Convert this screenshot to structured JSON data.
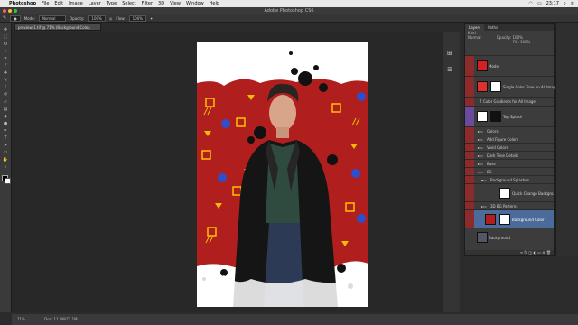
{
  "menubar": {
    "app": "Photoshop",
    "items": [
      "File",
      "Edit",
      "Image",
      "Layer",
      "Type",
      "Select",
      "Filter",
      "3D",
      "View",
      "Window",
      "Help"
    ],
    "time": "23:17"
  },
  "window": {
    "title": "Adobe Photoshop CS6"
  },
  "options": {
    "mode_label": "Mode:",
    "mode_value": "Normal",
    "opacity_label": "Opacity:",
    "opacity_value": "100%",
    "flow_label": "Flow:",
    "flow_value": "100%"
  },
  "document": {
    "tab": "preview-1.tif @ 71% (Background Color, RGB/8) *"
  },
  "layers_panel": {
    "tabs": [
      "Layers",
      "Paths"
    ],
    "kind": "Kind",
    "blend": "Normal",
    "opacity_label": "Opacity:",
    "opacity_value": "100%",
    "fill_label": "Fill:",
    "fill_value": "100%",
    "layers": [
      {
        "name": "Model"
      },
      {
        "name": "Single Color Tone on All Image"
      },
      {
        "name": "7 Color Gradients for All Image"
      },
      {
        "name": "Top Splash"
      },
      {
        "name": "Colors"
      },
      {
        "name": "Add Figure Colors"
      },
      {
        "name": "Vivid Colors"
      },
      {
        "name": "Dark Tone Details"
      },
      {
        "name": "Base"
      },
      {
        "name": "BG"
      },
      {
        "name": "Background Splashes"
      },
      {
        "name": "Quick Change Backgro..."
      },
      {
        "name": "3D BG Patterns"
      },
      {
        "name": "Background Color"
      },
      {
        "name": "Background"
      }
    ]
  },
  "status": {
    "zoom": "71%",
    "doc": "Doc: 11.9M/73.1M"
  },
  "colors": {
    "accent": "#b01e1e",
    "selected": "#4b6b9a"
  }
}
